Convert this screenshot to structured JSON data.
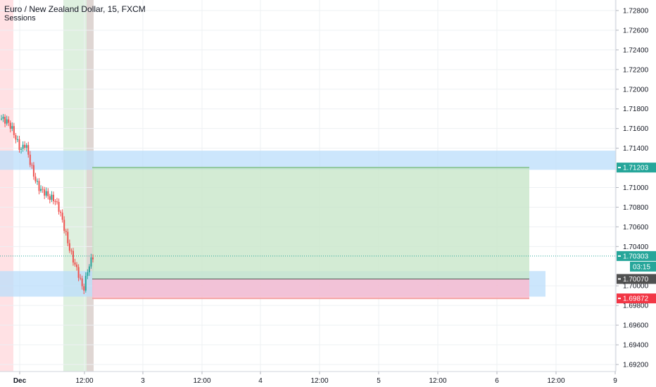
{
  "header": {
    "title": "Euro / New Zealand Dollar, 15, FXCM",
    "indicator": "Sessions"
  },
  "colors": {
    "up": "#26a69a",
    "down": "#ef5350",
    "profit_zone": "#c8e6c9",
    "loss_zone": "#f8bbd0",
    "support_zone": "#bbdefb",
    "session_red": "#ffcdd2",
    "session_green": "#c8e6c9",
    "session_tan": "#d7ccc8",
    "target_tag": "#26a69a",
    "current_tag": "#26a69a",
    "entry_tag": "#505050",
    "stop_tag": "#f23645"
  },
  "chart_data": {
    "type": "candlestick",
    "symbol": "EURNZD",
    "timeframe": "15",
    "source": "FXCM",
    "ylim": [
      1.691,
      1.729
    ],
    "y_ticks": [
      "1.72800",
      "1.72600",
      "1.72400",
      "1.72200",
      "1.72000",
      "1.71800",
      "1.71600",
      "1.71400",
      "1.71000",
      "1.70800",
      "1.70600",
      "1.70400",
      "1.70000",
      "1.69800",
      "1.69600",
      "1.69400",
      "1.69200"
    ],
    "x_ticks": [
      "Dec",
      "12:00",
      "3",
      "12:00",
      "4",
      "12:00",
      "5",
      "12:00",
      "6",
      "12:00",
      "9"
    ],
    "price_path": [
      1.717,
      1.7168,
      1.7162,
      1.715,
      1.7138,
      1.7145,
      1.7125,
      1.7108,
      1.7098,
      1.7095,
      1.709,
      1.7088,
      1.7078,
      1.706,
      1.704,
      1.7025,
      1.7012,
      1.6995,
      1.7018,
      1.703
    ],
    "levels": {
      "target": {
        "value": 1.71203,
        "label": "1.71203"
      },
      "current": {
        "value": 1.70303,
        "label": "1.70303",
        "countdown": "03:15"
      },
      "entry": {
        "value": 1.7007,
        "label": "1.70070"
      },
      "stop": {
        "value": 1.69872,
        "label": "1.69872"
      }
    },
    "zones": [
      {
        "name": "resistance-zone",
        "from": 1.7118,
        "to": 1.71375
      },
      {
        "name": "support-zone",
        "from": 1.6989,
        "to": 1.7015
      }
    ],
    "grid": true
  }
}
